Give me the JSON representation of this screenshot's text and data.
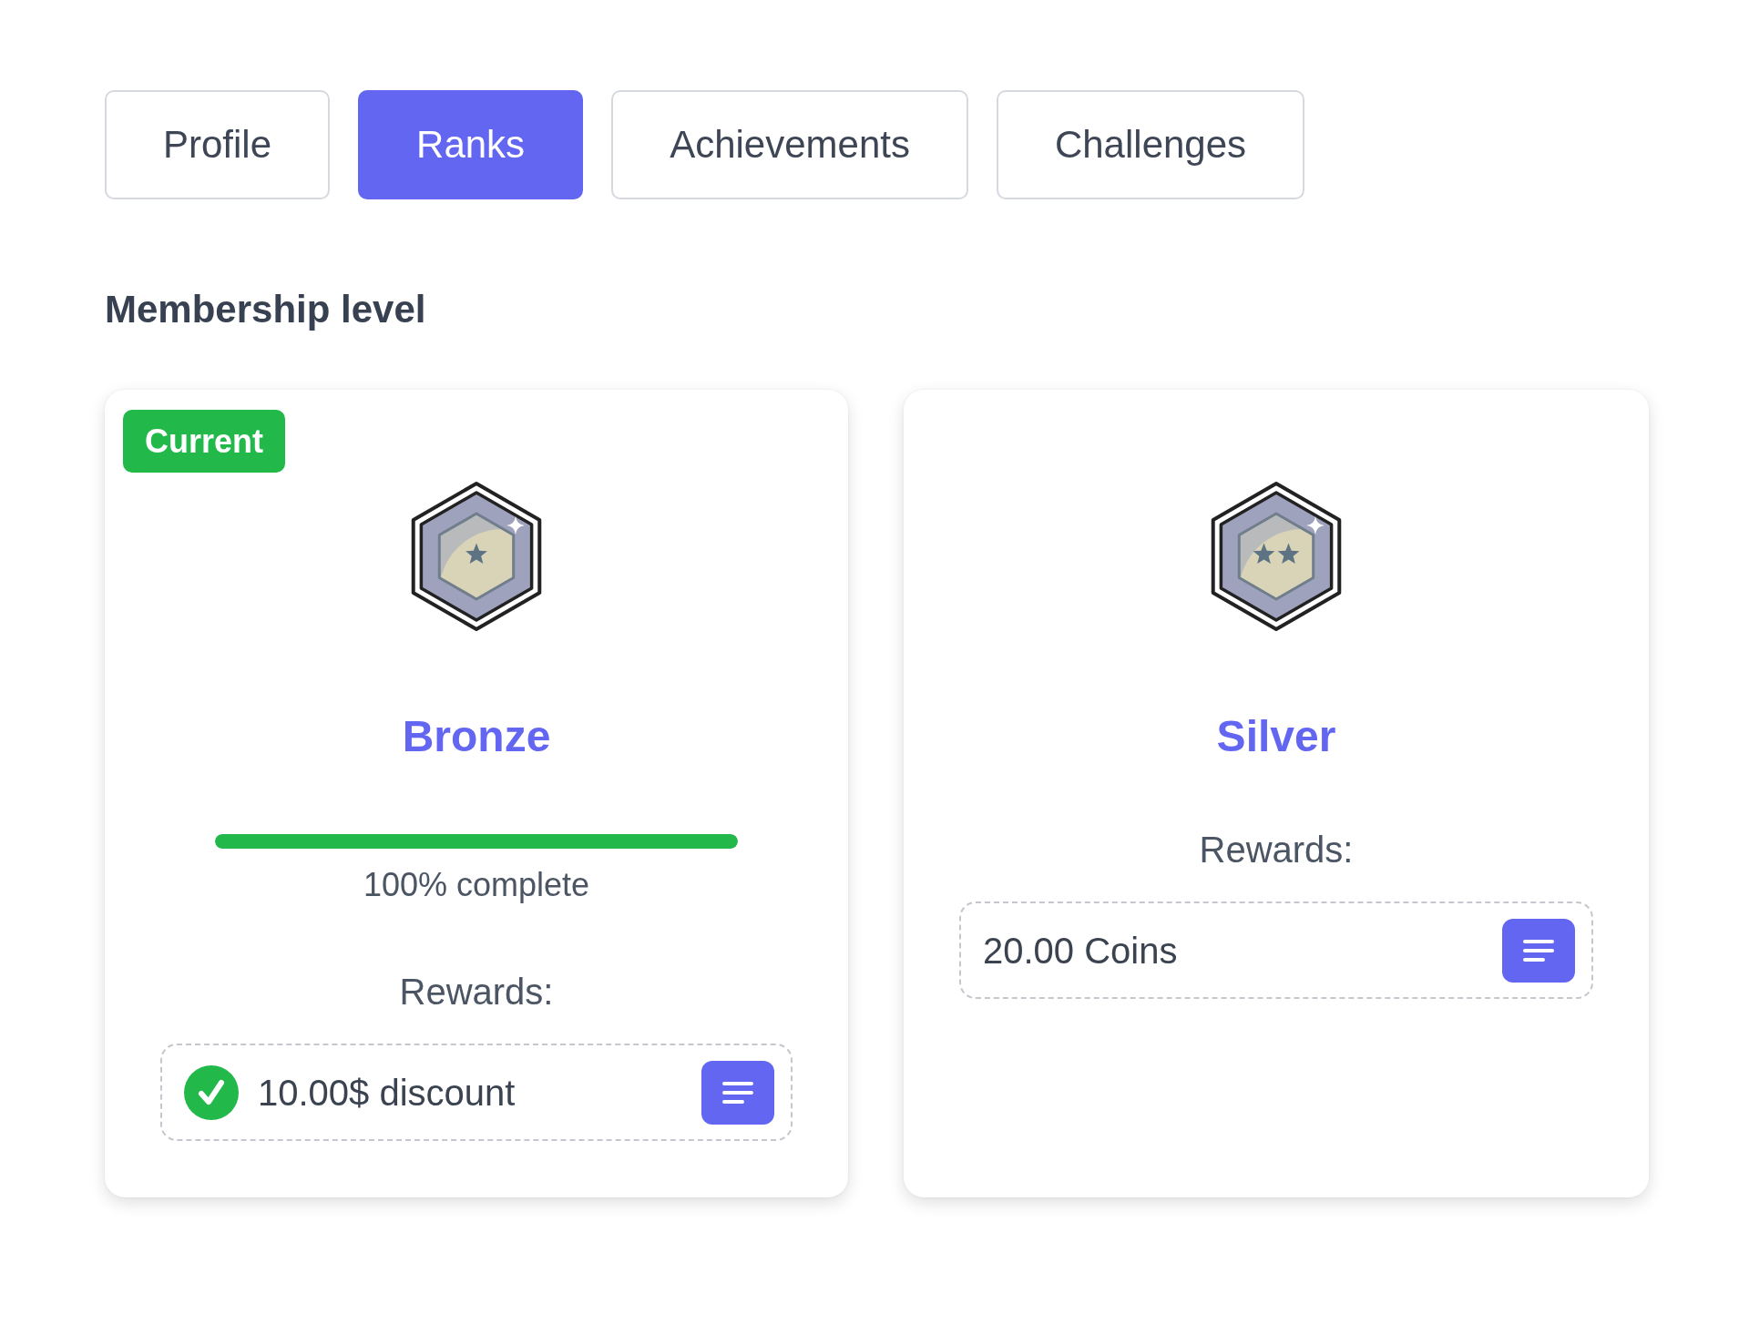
{
  "tabs": [
    {
      "label": "Profile",
      "selected": false
    },
    {
      "label": "Ranks",
      "selected": true
    },
    {
      "label": "Achievements",
      "selected": false
    },
    {
      "label": "Challenges",
      "selected": false
    }
  ],
  "section_title": "Membership level",
  "levels": [
    {
      "kind": "single",
      "status_tag": "Current",
      "name": "Bronze",
      "progress": {
        "level": 1,
        "reading": "100% complete"
      },
      "rewards_label": "Rewards:",
      "rewards": [
        {
          "text": "10.00$ discount",
          "claimed": true
        }
      ]
    },
    {
      "kind": "double",
      "name": "Silver",
      "rewards_label": "Rewards:",
      "rewards": [
        {
          "text": "20.00 Coins",
          "claimed": false
        }
      ]
    }
  ]
}
